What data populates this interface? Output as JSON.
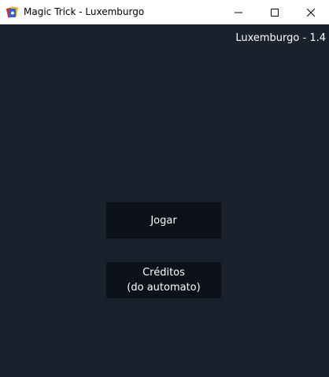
{
  "window": {
    "title": "Magic Trick - Luxemburgo",
    "icon": "magic-trick-app-icon"
  },
  "header": {
    "version_label": "Luxemburgo - 1.4"
  },
  "menu": {
    "play_label": "Jogar",
    "credits_line1": "Créditos",
    "credits_line2": "(do automato)"
  },
  "colors": {
    "background": "#1b202d",
    "button_bg": "#0d111a",
    "text": "#ffffff"
  }
}
